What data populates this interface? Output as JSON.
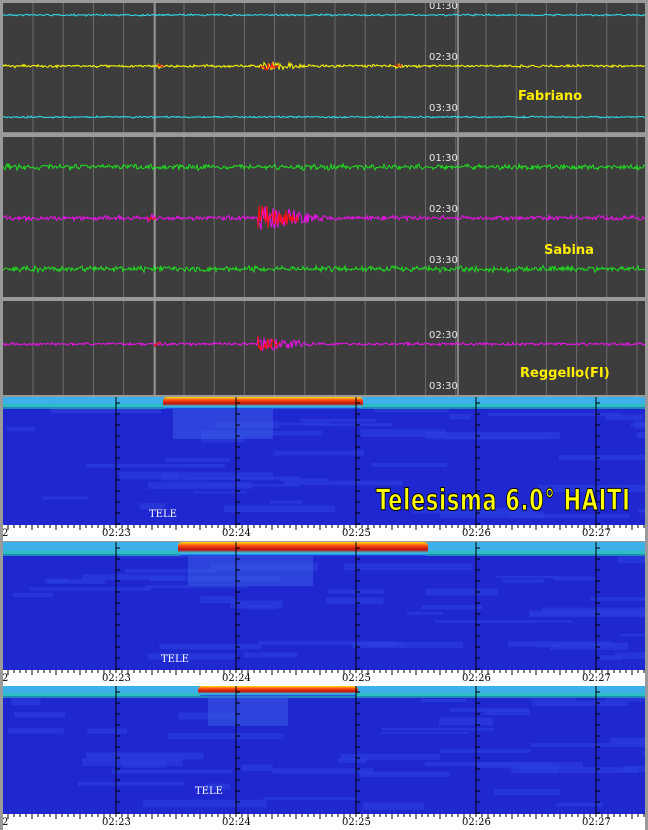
{
  "banner": "Telesisma 6.0° HAITI",
  "colors": {
    "panel_bg": "#3d3d3d",
    "cyan": "#30e0f0",
    "yellow": "#ffff00",
    "green": "#20e020",
    "magenta": "#f010f0",
    "red": "#ff1010",
    "spectro_bg": "#1420c8",
    "station_text": "#ffee00"
  },
  "seismo_panels": [
    {
      "station": "Fabriano",
      "traces": [
        {
          "time": "01:30",
          "color": "cyan"
        },
        {
          "time": "02:30",
          "color": "yellow"
        },
        {
          "time": "03:30",
          "color": "cyan"
        }
      ]
    },
    {
      "station": "Sabina",
      "traces": [
        {
          "time": "01:30",
          "color": "green"
        },
        {
          "time": "02:30",
          "color": "magenta"
        },
        {
          "time": "03:30",
          "color": "green"
        }
      ]
    },
    {
      "station": "Reggello(FI)",
      "traces": [
        {
          "time": "02:30",
          "color": "magenta"
        },
        {
          "time": "03:30",
          "color": "none"
        }
      ]
    }
  ],
  "spectrograms": [
    {
      "label": "TELE",
      "axis": [
        "2",
        "02:23",
        "02:24",
        "02:25",
        "02:26",
        "02:27"
      ]
    },
    {
      "label": "TELE",
      "axis": [
        "2",
        "02:23",
        "02:24",
        "02:25",
        "02:26",
        "02:27"
      ]
    },
    {
      "label": "TELE",
      "axis": [
        "2",
        "02:23",
        "02:24",
        "02:25",
        "02:26",
        "02:27"
      ]
    }
  ]
}
